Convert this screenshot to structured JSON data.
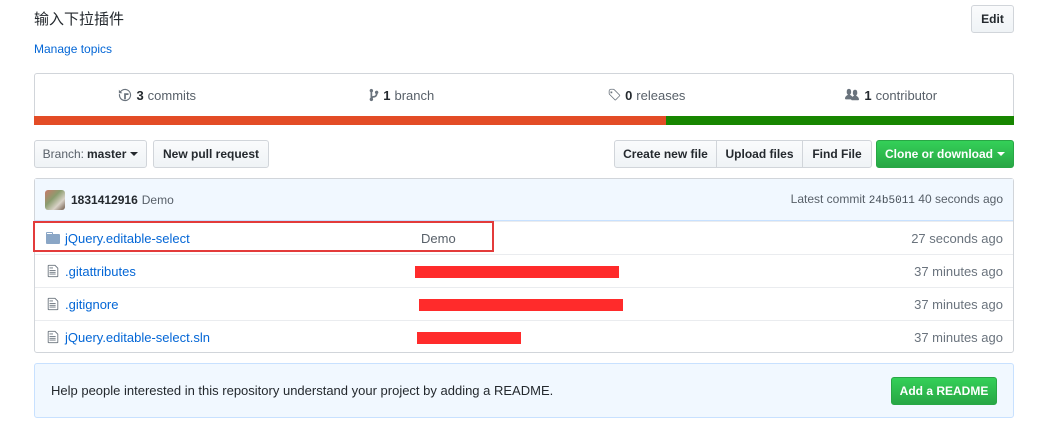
{
  "repo": {
    "description": "输入下拉插件",
    "manage_topics": "Manage topics",
    "edit_label": "Edit"
  },
  "summary": {
    "commits_count": "3",
    "commits_label": "commits",
    "branch_count": "1",
    "branch_label": "branch",
    "releases_count": "0",
    "releases_label": "releases",
    "contributors_count": "1",
    "contributors_label": "contributor"
  },
  "language_bar": {
    "colors": [
      "#e34c26",
      "#178600"
    ],
    "shares": [
      0.645,
      0.355
    ]
  },
  "filebar": {
    "branch_prefix": "Branch:",
    "branch_name": "master",
    "new_pr": "New pull request",
    "create_file": "Create new file",
    "upload_files": "Upload files",
    "find_file": "Find File",
    "clone": "Clone or download"
  },
  "commit": {
    "author": "1831412916",
    "message": "Demo",
    "latest_prefix": "Latest commit",
    "sha": "24b5011",
    "age": "40 seconds ago"
  },
  "files": [
    {
      "name": "jQuery.editable-select",
      "type": "folder",
      "message": "Demo",
      "age": "27 seconds ago"
    },
    {
      "name": ".gitattributes",
      "type": "file",
      "message": "",
      "age": "37 minutes ago"
    },
    {
      "name": ".gitignore",
      "type": "file",
      "message": "",
      "age": "37 minutes ago"
    },
    {
      "name": "jQuery.editable-select.sln",
      "type": "file",
      "message": "",
      "age": "37 minutes ago"
    }
  ],
  "readme": {
    "text": "Help people interested in this repository understand your project by adding a README.",
    "button": "Add a README"
  },
  "colors": {
    "link": "#0366d6",
    "primary_green": "#28a745",
    "redaction": "#ff2b2b",
    "highlight_box": "#e33b3b"
  }
}
